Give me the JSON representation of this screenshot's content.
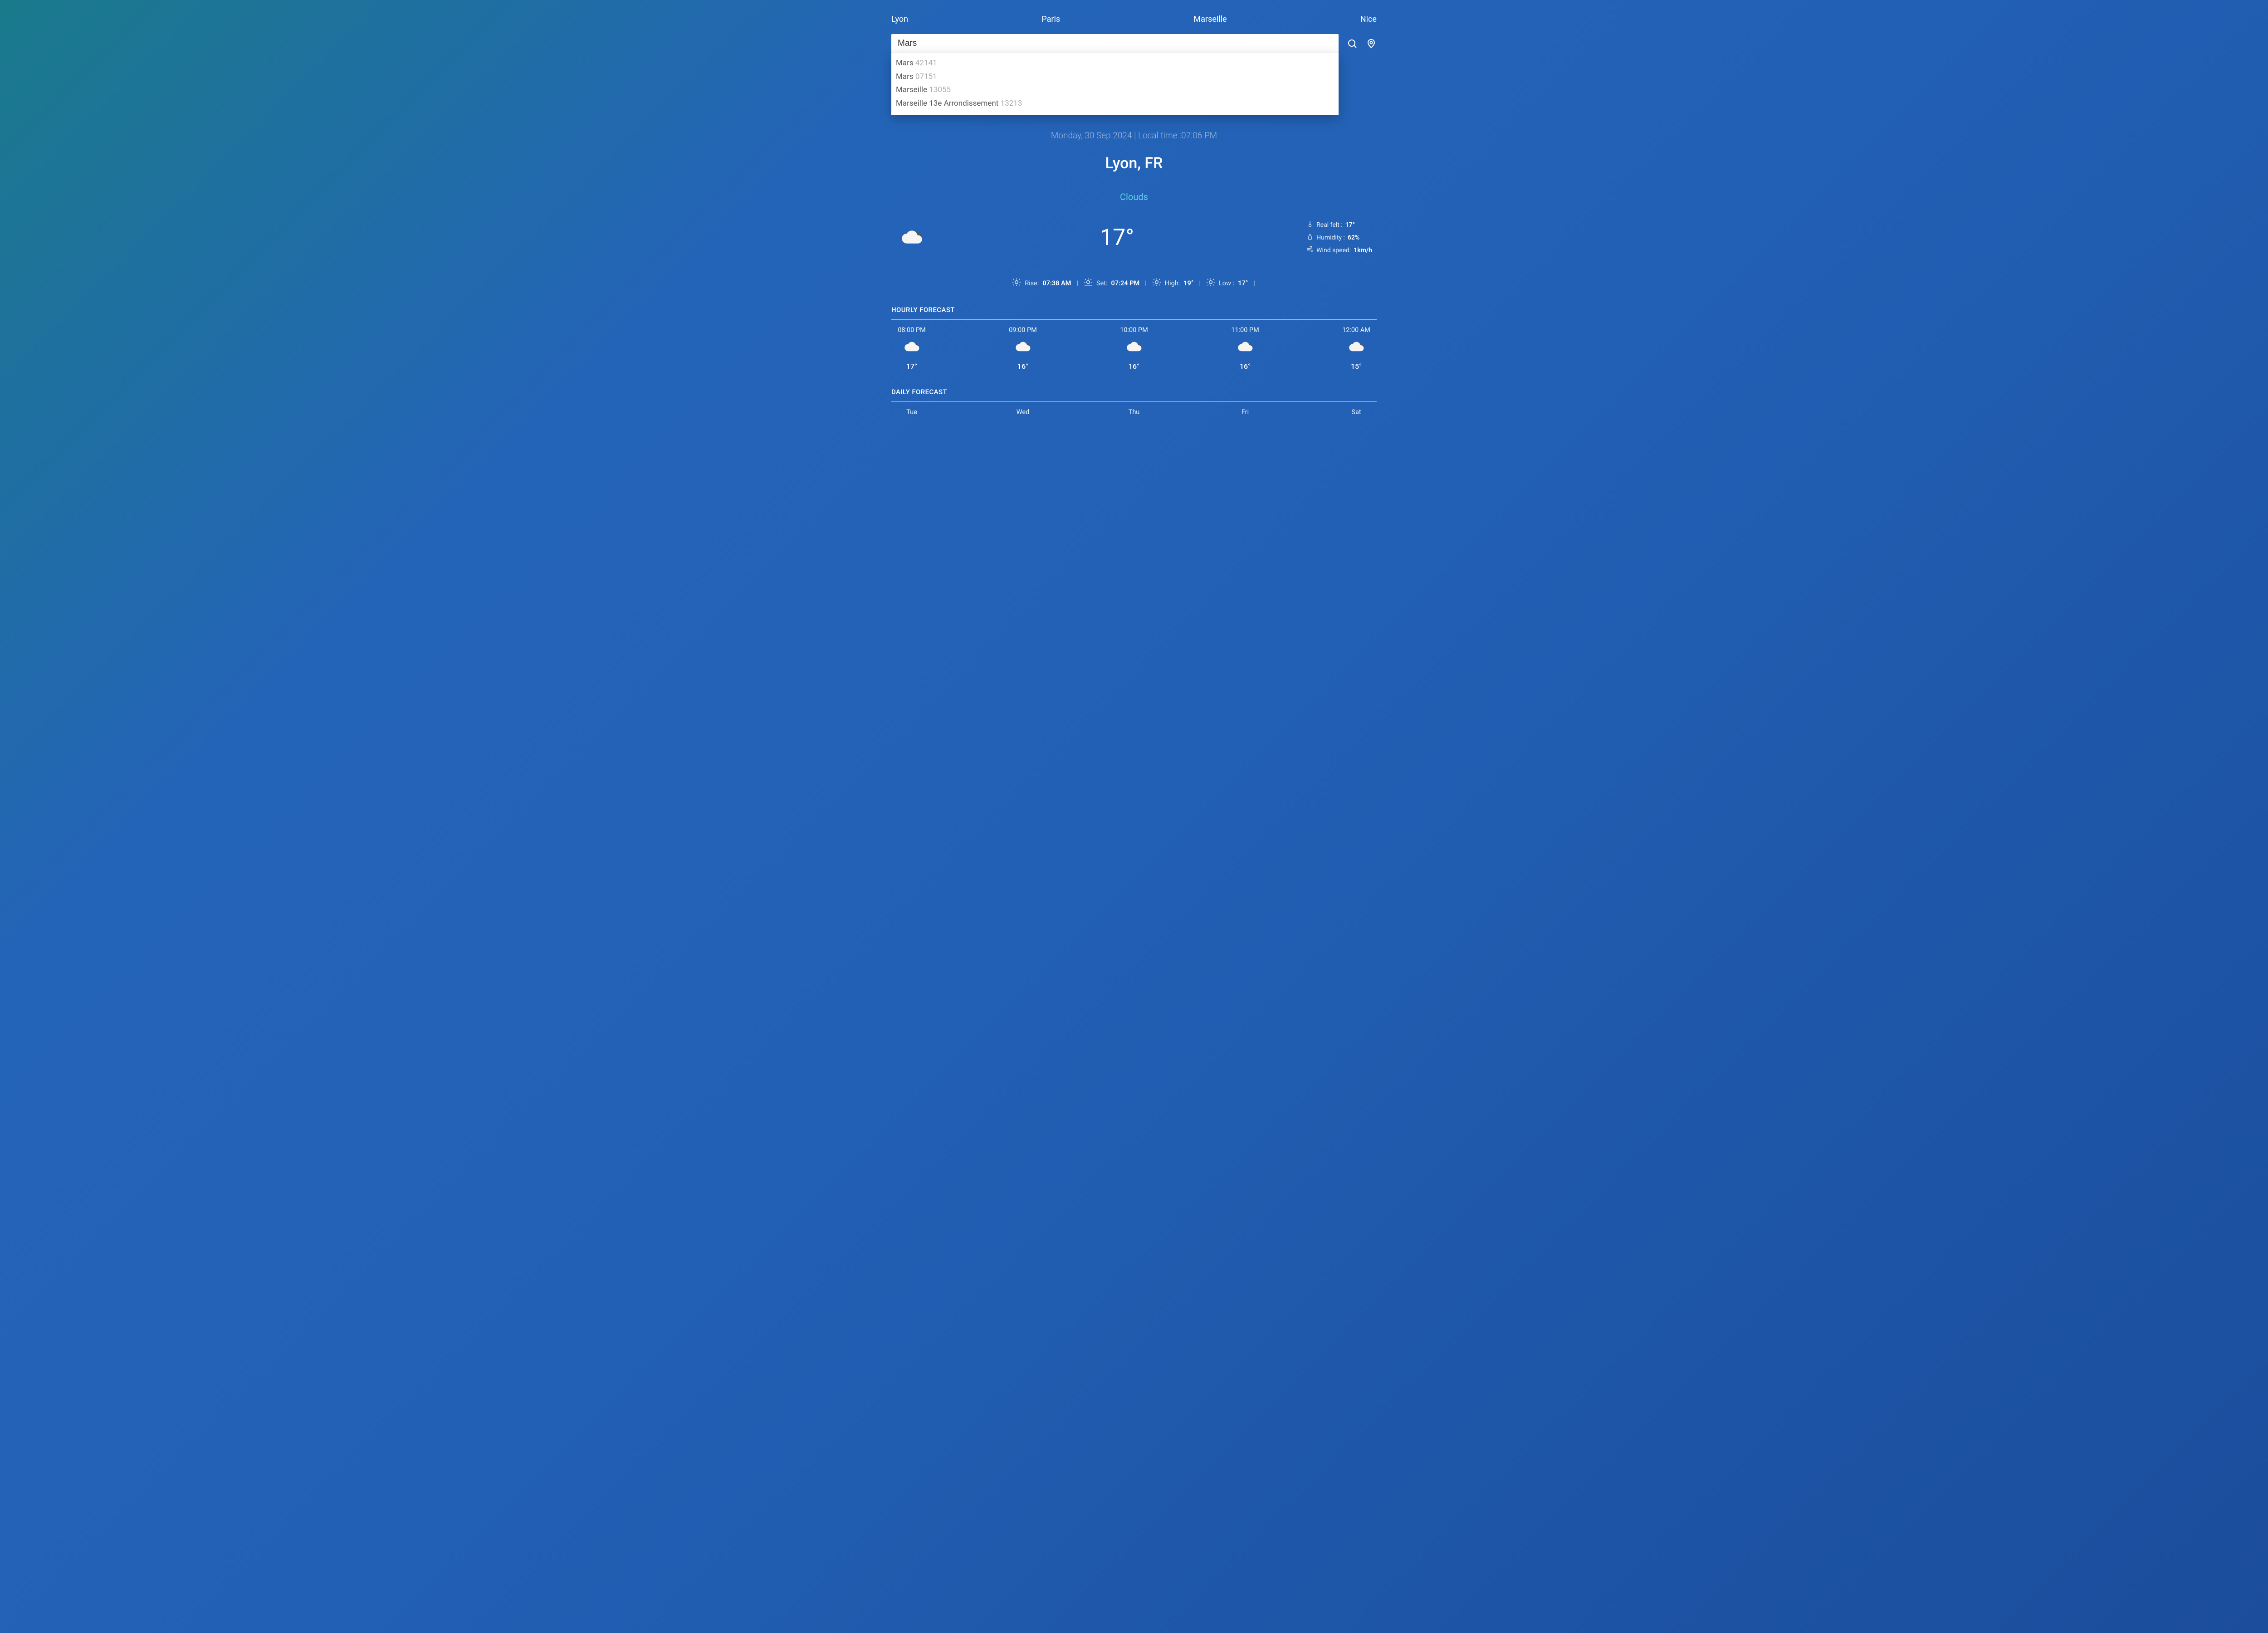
{
  "tabs": [
    "Lyon",
    "Paris",
    "Marseille",
    "Nice"
  ],
  "search": {
    "value": "Mars",
    "placeholder": "",
    "suggestions": [
      {
        "name": "Mars",
        "code": "42141"
      },
      {
        "name": "Mars",
        "code": "07151"
      },
      {
        "name": "Marseille",
        "code": "13055"
      },
      {
        "name": "Marseille 13e Arrondissement",
        "code": "13213"
      }
    ]
  },
  "datetime": "Monday, 30 Sep 2024 | Local time :07:06 PM",
  "location": "Lyon, FR",
  "condition": "Clouds",
  "temp": "17°",
  "details": {
    "real_felt_label": "Real felt :",
    "real_felt_value": "17°",
    "humidity_label": "Humidity :",
    "humidity_value": "62%",
    "wind_label": "Wind speed:",
    "wind_value": "1km/h"
  },
  "sun": {
    "rise_label": "Rise:",
    "rise_value": "07:38 AM",
    "set_label": "Set:",
    "set_value": "07:24 PM",
    "high_label": "High:",
    "high_value": "19°",
    "low_label": "Low :",
    "low_value": "17°"
  },
  "hourly_title": "HOURLY FORECAST",
  "hourly": [
    {
      "time": "08:00 PM",
      "temp": "17°"
    },
    {
      "time": "09:00 PM",
      "temp": "16°"
    },
    {
      "time": "10:00 PM",
      "temp": "16°"
    },
    {
      "time": "11:00 PM",
      "temp": "16°"
    },
    {
      "time": "12:00 AM",
      "temp": "15°"
    }
  ],
  "daily_title": "DAILY FORECAST",
  "daily": [
    {
      "day": "Tue"
    },
    {
      "day": "Wed"
    },
    {
      "day": "Thu"
    },
    {
      "day": "Fri"
    },
    {
      "day": "Sat"
    }
  ]
}
